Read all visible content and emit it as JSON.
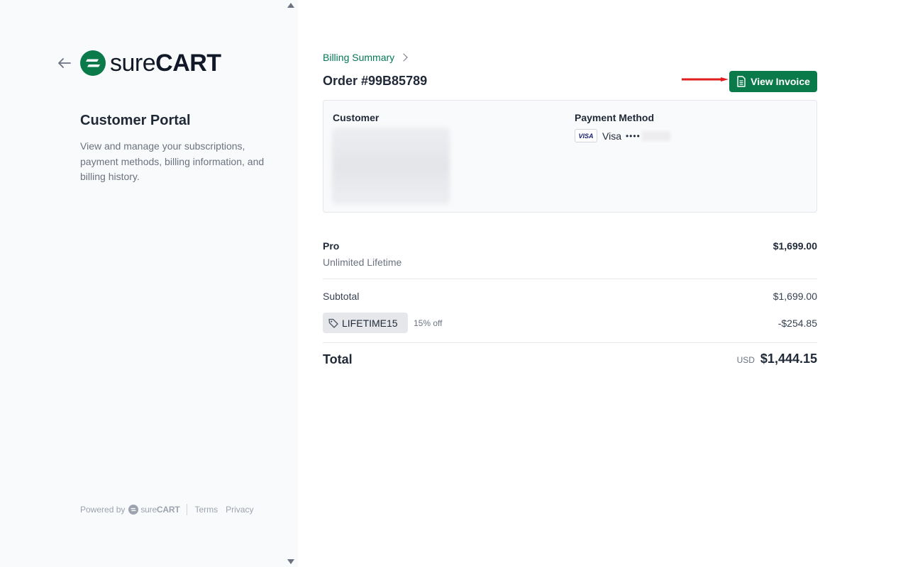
{
  "sidebar": {
    "logo": {
      "word_regular": "sure",
      "word_bold": "CART",
      "brand_color": "#0b7a4b"
    },
    "title": "Customer Portal",
    "description": "View and manage your subscriptions, payment methods, billing information, and billing history.",
    "footer": {
      "powered_by": "Powered by",
      "logo_regular": "sure",
      "logo_bold": "CART",
      "terms": "Terms",
      "privacy": "Privacy"
    }
  },
  "main": {
    "breadcrumb": "Billing Summary",
    "order_title": "Order #99B85789",
    "view_invoice_label": "View Invoice",
    "customer_label": "Customer",
    "payment_method_label": "Payment Method",
    "payment": {
      "brand_badge": "VISA",
      "brand_name": "Visa",
      "masked": "••••"
    },
    "line_item": {
      "name": "Pro",
      "description": "Unlimited Lifetime",
      "price": "$1,699.00"
    },
    "subtotal": {
      "label": "Subtotal",
      "value": "$1,699.00"
    },
    "coupon": {
      "code": "LIFETIME15",
      "off": "15% off",
      "discount": "-$254.85"
    },
    "total": {
      "label": "Total",
      "currency": "USD",
      "value": "$1,444.15"
    }
  },
  "colors": {
    "accent": "#0b7a4b",
    "annotation_arrow": "#e11d1d"
  }
}
